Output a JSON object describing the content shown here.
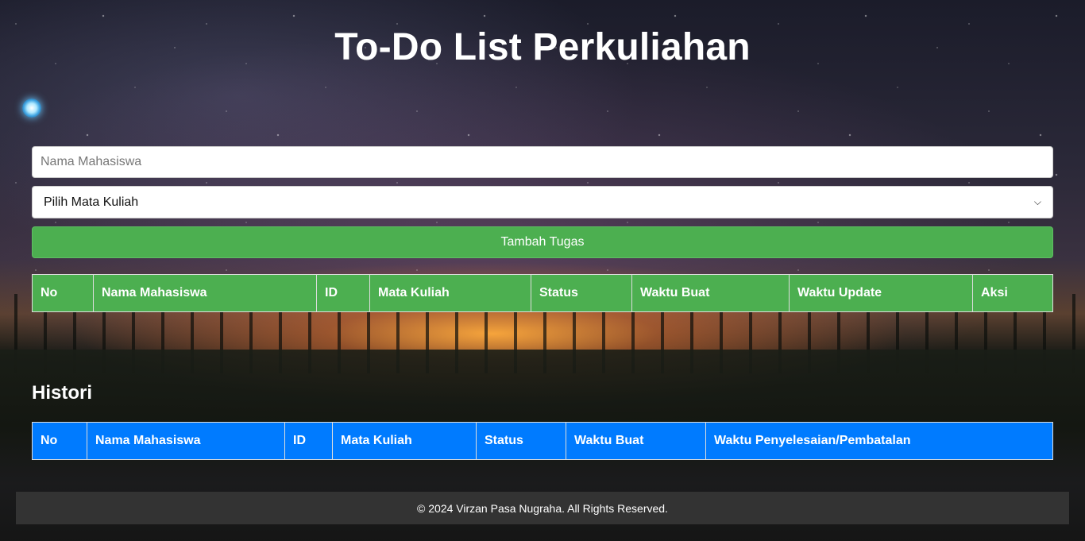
{
  "header": {
    "title": "To-Do List Perkuliahan"
  },
  "form": {
    "name_placeholder": "Nama Mahasiswa",
    "course_selected": "Pilih Mata Kuliah",
    "submit_label": "Tambah Tugas"
  },
  "task_table": {
    "headers": [
      "No",
      "Nama Mahasiswa",
      "ID",
      "Mata Kuliah",
      "Status",
      "Waktu Buat",
      "Waktu Update",
      "Aksi"
    ]
  },
  "history": {
    "title": "Histori",
    "headers": [
      "No",
      "Nama Mahasiswa",
      "ID",
      "Mata Kuliah",
      "Status",
      "Waktu Buat",
      "Waktu Penyelesaian/Pembatalan"
    ]
  },
  "footer": {
    "text": "© 2024 Virzan Pasa Nugraha. All Rights Reserved."
  },
  "colors": {
    "task_header": "#4caf50",
    "history_header": "#007bff",
    "footer_bg": "#333333"
  },
  "icons": {
    "select_arrow": "chevron-down-icon",
    "orb": "glowing-orb-icon"
  }
}
